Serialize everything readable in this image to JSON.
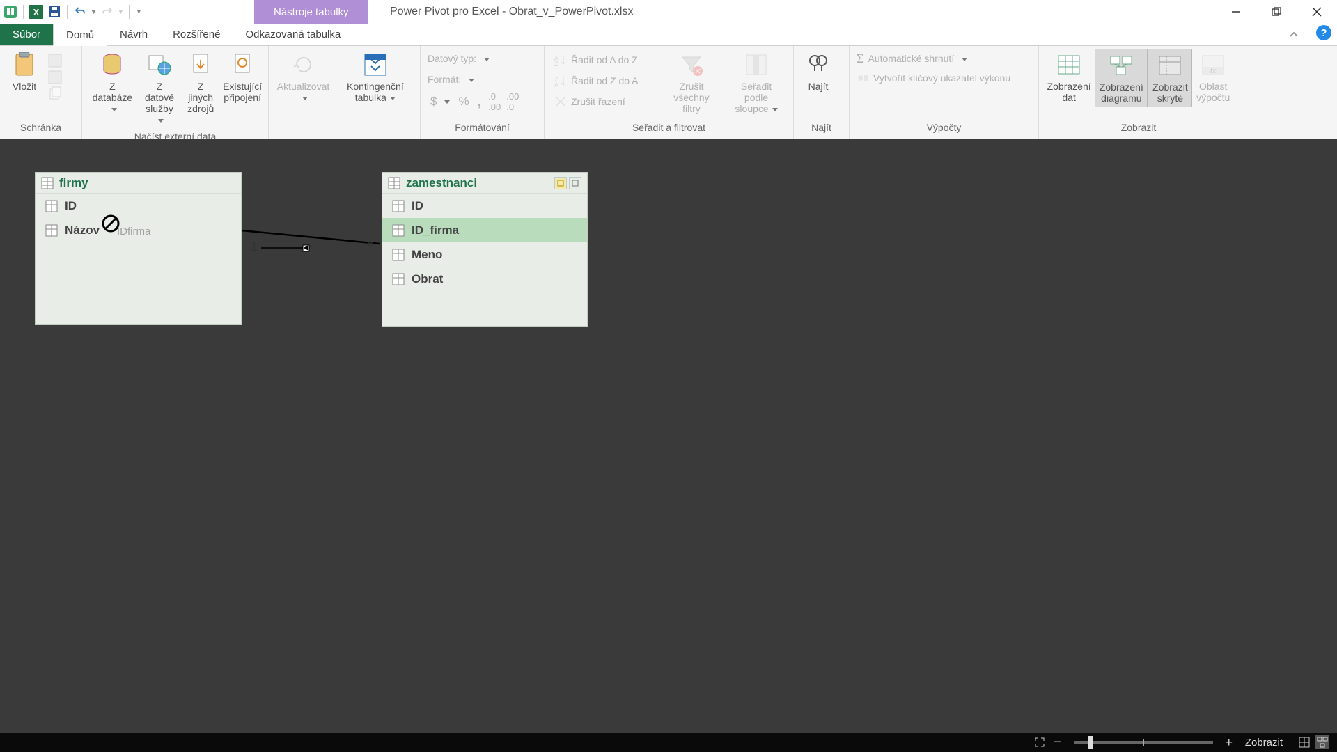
{
  "titlebar": {
    "context_tab": "Nástroje tabulky",
    "app_title": "Power Pivot pro Excel - Obrat_v_PowerPivot.xlsx"
  },
  "tabs": {
    "file": "Súbor",
    "home": "Domů",
    "design": "Návrh",
    "advanced": "Rozšířené",
    "linked": "Odkazovaná tabulka"
  },
  "ribbon": {
    "clipboard": {
      "title": "Schránka",
      "paste": "Vložit"
    },
    "external": {
      "title": "Načíst externí data",
      "db": "Z\ndatabáze",
      "service": "Z datové\nslužby",
      "other": "Z jiných\nzdrojů",
      "existing": "Existující\npřipojení"
    },
    "refresh": "Aktualizovat",
    "pivot": "Kontingenční\ntabulka",
    "formatting": {
      "title": "Formátování",
      "datatype": "Datový typ:",
      "format": "Formát:"
    },
    "sort": {
      "title": "Seřadit a filtrovat",
      "asc": "Řadit od A do Z",
      "desc": "Řadit od Z do A",
      "clear_sort": "Zrušit řazení",
      "clear_filters": "Zrušit\nvšechny filtry",
      "sort_cols": "Seřadit podle\nsloupce"
    },
    "find": {
      "title": "Najít",
      "find": "Najít"
    },
    "calc": {
      "title": "Výpočty",
      "autosum": "Automatické shrnutí",
      "kpi": "Vytvořit klíčový ukazatel výkonu"
    },
    "view": {
      "title": "Zobrazit",
      "data": "Zobrazení\ndat",
      "diagram": "Zobrazení\ndiagramu",
      "hidden": "Zobrazit\nskryté",
      "calc_area": "Oblast\nvýpočtu"
    }
  },
  "canvas": {
    "table1": {
      "name": "firmy",
      "fields": [
        "ID",
        "Názov"
      ]
    },
    "table2": {
      "name": "zamestnanci",
      "fields": [
        "ID",
        "ID_firma",
        "Meno",
        "Obrat"
      ],
      "selected_index": 1
    },
    "relation": {
      "left": "1",
      "right": "*"
    },
    "drag_label": "IDfirma"
  },
  "statusbar": {
    "view_label": "Zobrazit"
  }
}
